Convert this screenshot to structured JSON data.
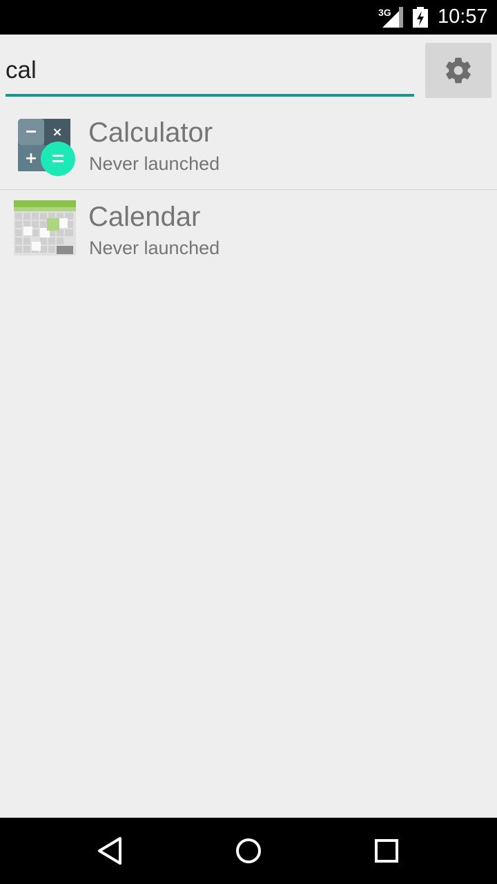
{
  "status_bar": {
    "network": "3G",
    "time": "10:57",
    "signal_icon": "signal-icon",
    "battery_icon": "battery-charging-icon"
  },
  "search": {
    "query": "cal",
    "accent_color": "#1a9688"
  },
  "settings": {
    "icon": "gear-icon"
  },
  "apps": [
    {
      "name": "Calculator",
      "subtitle": "Never launched",
      "icon": "calculator-icon"
    },
    {
      "name": "Calendar",
      "subtitle": "Never launched",
      "icon": "calendar-icon"
    }
  ],
  "nav": {
    "back_icon": "back-icon",
    "home_icon": "home-icon",
    "recents_icon": "recents-icon"
  }
}
